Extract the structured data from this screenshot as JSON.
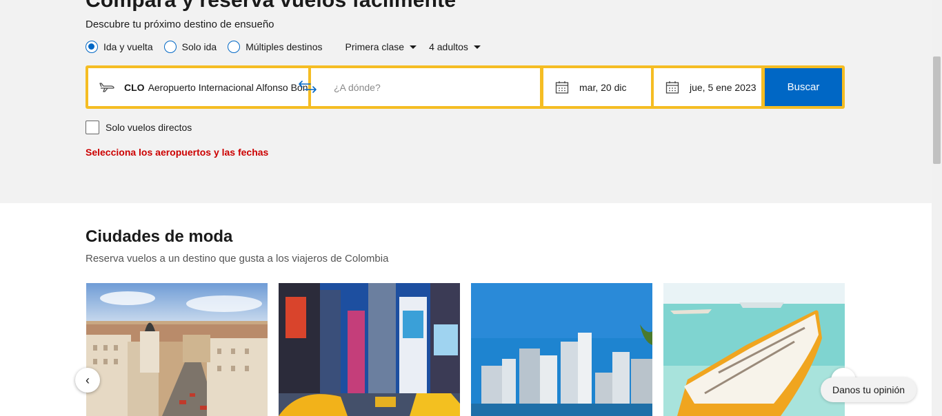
{
  "hero": {
    "title": "Compara y reserva vuelos fácilmente",
    "subtitle": "Descubre tu próximo destino de ensueño"
  },
  "trip_options": [
    {
      "label": "Ida y vuelta",
      "selected": true
    },
    {
      "label": "Solo ida",
      "selected": false
    },
    {
      "label": "Múltiples destinos",
      "selected": false
    }
  ],
  "cabin_class": "Primera clase",
  "passengers": "4 adultos",
  "search": {
    "origin_code": "CLO",
    "origin_name": "Aeropuerto Internacional Alfonso Bonilla Aragón",
    "destination_placeholder": "¿A dónde?",
    "departure_date": "mar, 20 dic",
    "return_date": "jue, 5 ene 2023",
    "button_label": "Buscar"
  },
  "direct_flights_label": "Solo vuelos directos",
  "error_message": "Selecciona los aeropuertos y las fechas",
  "trending": {
    "heading": "Ciudades de moda",
    "subheading": "Reserva vuelos a un destino que gusta a los viajeros de Colombia"
  },
  "feedback_label": "Danos tu opinión",
  "colors": {
    "accent": "#0067c5",
    "search_border": "#f5bd23",
    "error": "#cc0000"
  }
}
